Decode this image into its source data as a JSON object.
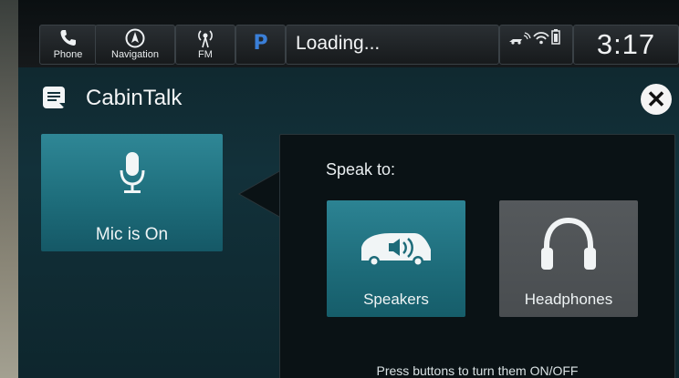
{
  "statusbar": {
    "phone_label": "Phone",
    "navigation_label": "Navigation",
    "fm_label": "FM",
    "pandora_letter": "P",
    "loading_text": "Loading...",
    "time": "3:17",
    "icons": [
      "phone-icon",
      "navigation-icon",
      "fm-radio-icon",
      "pandora-icon",
      "vehicle-signal-icon",
      "wifi-icon",
      "battery-icon"
    ]
  },
  "header": {
    "title": "CabinTalk",
    "app_icon": "cabintalk-icon",
    "close_icon": "close-icon"
  },
  "mic": {
    "label": "Mic is On",
    "icon": "microphone-icon"
  },
  "panel": {
    "heading": "Speak to:",
    "tiles": [
      {
        "label": "Speakers",
        "icon": "car-speaker-icon",
        "state": "on"
      },
      {
        "label": "Headphones",
        "icon": "headphones-icon",
        "state": "off"
      }
    ],
    "hint": "Press buttons to turn them ON/OFF"
  },
  "colors": {
    "active_tile": "#1e6e7c",
    "inactive_tile": "#4a4e51",
    "background": "#12313a"
  }
}
